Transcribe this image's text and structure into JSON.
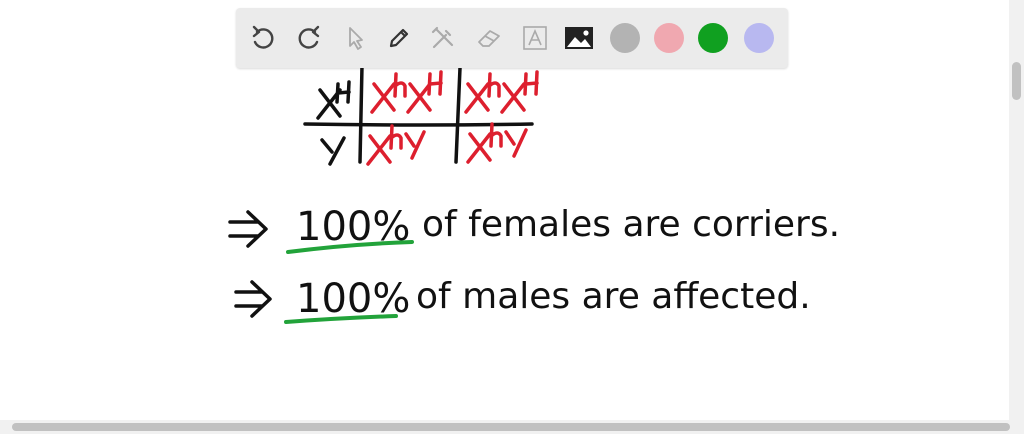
{
  "toolbar": {
    "tools": [
      {
        "name": "undo-icon"
      },
      {
        "name": "redo-icon"
      },
      {
        "name": "select-pointer-icon"
      },
      {
        "name": "pen-icon"
      },
      {
        "name": "tools-icon"
      },
      {
        "name": "eraser-icon"
      },
      {
        "name": "text-icon"
      },
      {
        "name": "image-icon"
      }
    ],
    "colors": [
      "#b3b3b3",
      "#f0a8b0",
      "#10a020",
      "#b8b8f0"
    ],
    "selected_color": "#10a020"
  },
  "whiteboard": {
    "punnett": {
      "rows": [
        {
          "header": "X^H",
          "cells": [
            "X^h X^H",
            "X^h X^H"
          ]
        },
        {
          "header": "Y",
          "cells": [
            "X^h Y",
            "X^h Y"
          ]
        }
      ]
    },
    "statements": [
      {
        "arrow": "⇒",
        "percent": "100%",
        "text": "of females are corriers."
      },
      {
        "arrow": "⇒",
        "percent": "100%",
        "text": "of males are affected."
      }
    ],
    "ink_colors": {
      "black": "#111111",
      "red": "#dd1f2e",
      "green": "#22a33a"
    }
  }
}
